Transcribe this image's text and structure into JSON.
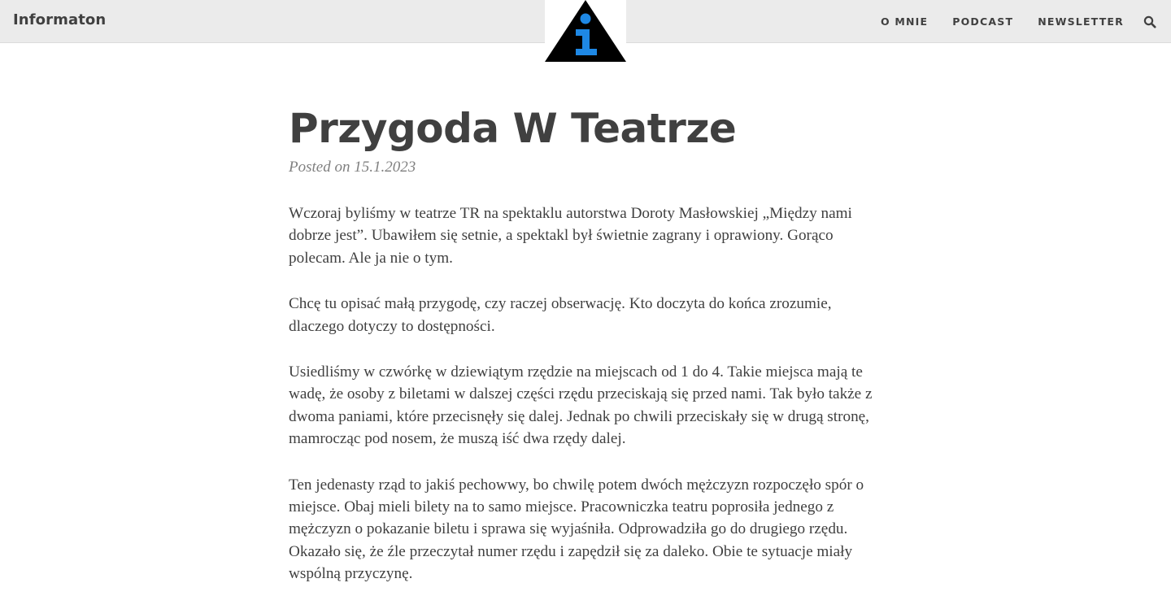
{
  "navbar": {
    "brand": "Informaton",
    "logo_icon": "info-triangle-icon",
    "links": [
      {
        "label": "O MNIE"
      },
      {
        "label": "PODCAST"
      },
      {
        "label": "NEWSLETTER"
      }
    ],
    "search_icon": "search-icon"
  },
  "post": {
    "title": "Przygoda W Teatrze",
    "meta": "Posted on 15.1.2023",
    "paragraphs": [
      "Wczoraj byliśmy w teatrze TR na spektaklu autorstwa Doroty Masłowskiej „Między nami dobrze jest”. Ubawiłem się setnie, a spektakl był świetnie zagrany i oprawiony. Gorąco polecam. Ale ja nie o tym.",
      "Chcę tu opisać małą przygodę, czy raczej obserwację. Kto doczyta do końca zrozumie, dlaczego dotyczy to dostępności.",
      "Usiedliśmy w czwórkę w dziewiątym rzędzie na miejscach od 1 do 4. Takie miejsca mają te wadę, że osoby z biletami w dalszej części rzędu przeciskają się przed nami. Tak było także z dwoma paniami, które przecisnęły się dalej. Jednak po chwili przeciskały się w drugą stronę, mamrocząc pod nosem, że muszą iść dwa rzędy dalej.",
      "Ten jedenasty rząd to jakiś pechowwy, bo chwilę potem dwóch mężczyzn rozpoczęło spór o miejsce. Obaj mieli bilety na to samo miejsce. Pracowniczka teatru poprosiła jednego z mężczyzn o pokazanie biletu i sprawa się wyjaśniła. Odprowadziła go do drugiego rzędu. Okazało się, że źle przeczytał numer rzędu i zapędził się za daleko. Obie te sytuacje miały wspólną przyczynę."
    ]
  },
  "colors": {
    "navbar_bg": "#ebebeb",
    "text": "#404040",
    "meta": "#808080",
    "logo_blue": "#1e88e5",
    "logo_black": "#000000"
  }
}
